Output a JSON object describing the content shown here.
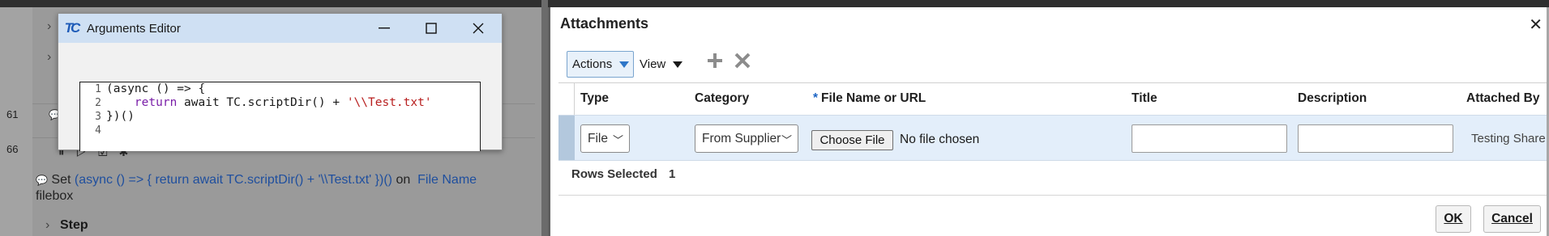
{
  "background": {
    "line_numbers": [
      "61",
      "66"
    ],
    "step_text": {
      "prefix": "Set",
      "value": "(async () => { return await TC.scriptDir() + '\\\\Test.txt' })()",
      "on": "on",
      "target": "File Name",
      "suffix": "filebox"
    },
    "step_label": "Step"
  },
  "args_editor": {
    "title": "Arguments Editor",
    "minimize": "—",
    "maximize": "☐",
    "close": "✕",
    "code_lines": [
      {
        "num": "1",
        "text": "(async () => {"
      },
      {
        "num": "2",
        "kw": "return",
        "mid": " await TC.scriptDir() + ",
        "str": "'\\\\Test.txt'"
      },
      {
        "num": "3",
        "text": "})()"
      },
      {
        "num": "4",
        "text": ""
      }
    ]
  },
  "attachments": {
    "title": "Attachments",
    "close": "✕",
    "actions_label": "Actions",
    "view_label": "View",
    "add_icon": "+",
    "delete_icon": "✖",
    "columns": {
      "type": "Type",
      "category": "Category",
      "required_mark": "*",
      "file": "File Name or URL",
      "title": "Title",
      "description": "Description",
      "attached_by": "Attached By"
    },
    "row": {
      "type": "File",
      "category": "From Supplier",
      "choose_file": "Choose File",
      "no_file": "No file chosen",
      "title": "",
      "description": "",
      "attached_by": "Testing Share"
    },
    "rows_selected_label": "Rows Selected",
    "rows_selected_count": "1",
    "ok_label": "OK",
    "cancel_label": "Cancel"
  }
}
